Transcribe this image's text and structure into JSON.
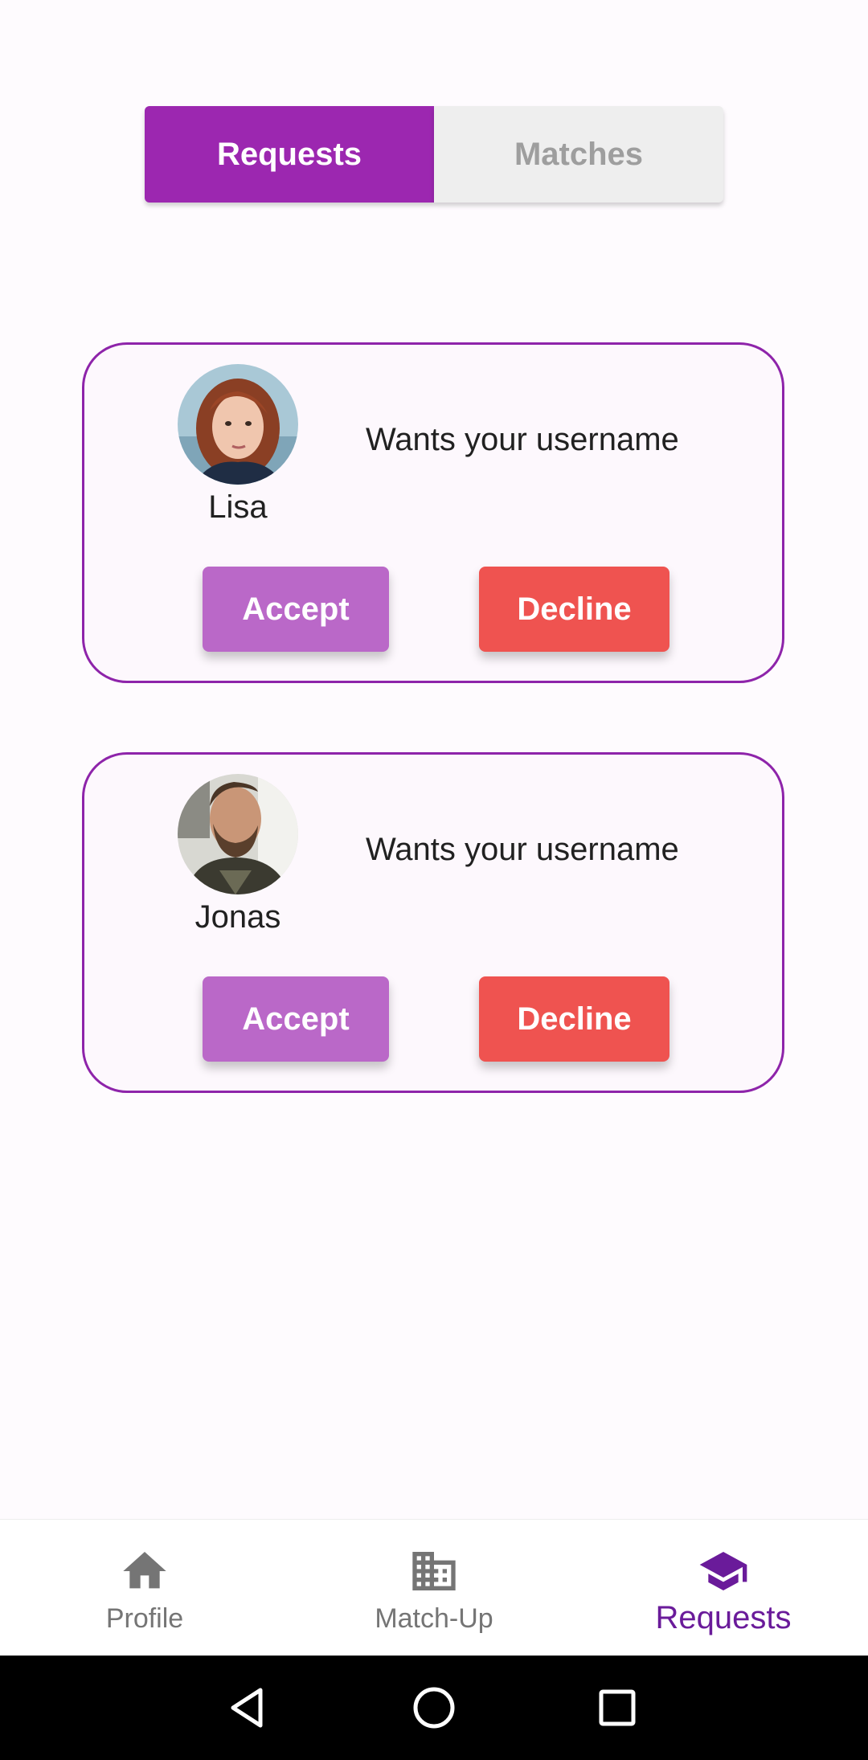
{
  "tabs": {
    "requests": "Requests",
    "matches": "Matches"
  },
  "requests": [
    {
      "name": "Lisa",
      "message": "Wants your username",
      "accept_label": "Accept",
      "decline_label": "Decline"
    },
    {
      "name": "Jonas",
      "message": "Wants your username",
      "accept_label": "Accept",
      "decline_label": "Decline"
    }
  ],
  "bottom_nav": [
    {
      "label": "Profile",
      "icon": "home-icon",
      "active": false
    },
    {
      "label": "Match-Up",
      "icon": "building-icon",
      "active": false
    },
    {
      "label": "Requests",
      "icon": "graduation-cap-icon",
      "active": true
    }
  ],
  "colors": {
    "primary": "#9c27b0",
    "accept": "#ba68c8",
    "decline": "#ef5350",
    "card_border": "#8e24aa",
    "nav_active": "#6a1b9a",
    "nav_inactive": "#757575"
  }
}
